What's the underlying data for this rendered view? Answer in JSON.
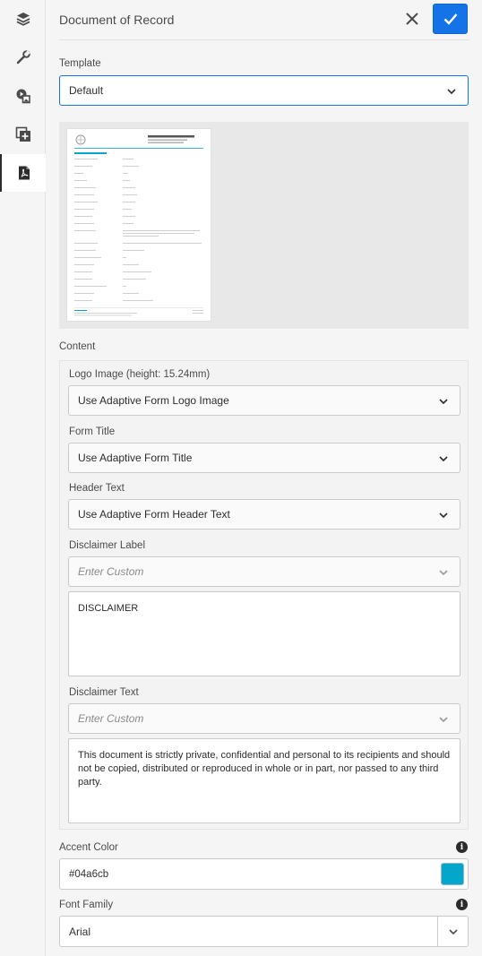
{
  "header": {
    "title": "Document of Record"
  },
  "template": {
    "label": "Template",
    "value": "Default"
  },
  "content": {
    "section_label": "Content",
    "logo": {
      "label": "Logo Image (height: 15.24mm)",
      "value": "Use Adaptive Form Logo Image"
    },
    "form_title": {
      "label": "Form Title",
      "value": "Use Adaptive Form Title"
    },
    "header_text": {
      "label": "Header Text",
      "value": "Use Adaptive Form Header Text"
    },
    "disclaimer_label": {
      "label": "Disclaimer Label",
      "placeholder": "Enter Custom",
      "text": "DISCLAIMER"
    },
    "disclaimer_text": {
      "label": "Disclaimer Text",
      "placeholder": "Enter Custom",
      "text": "This document is strictly private, confidential and personal to its recipients and should not be copied, distributed or reproduced in whole or in part, nor passed to any third party."
    }
  },
  "accent": {
    "label": "Accent Color",
    "value": "#04a6cb",
    "swatch": "#04a6cb"
  },
  "font": {
    "label": "Font Family",
    "value": "Arial"
  },
  "colors": {
    "primary": "#1473e6",
    "accent": "#04a6cb"
  },
  "icons": [
    "layers-icon",
    "wrench-icon",
    "media-icon",
    "add-panel-icon",
    "pdf-icon",
    "close-icon",
    "checkmark-icon",
    "chevron-down-icon",
    "info-icon"
  ]
}
